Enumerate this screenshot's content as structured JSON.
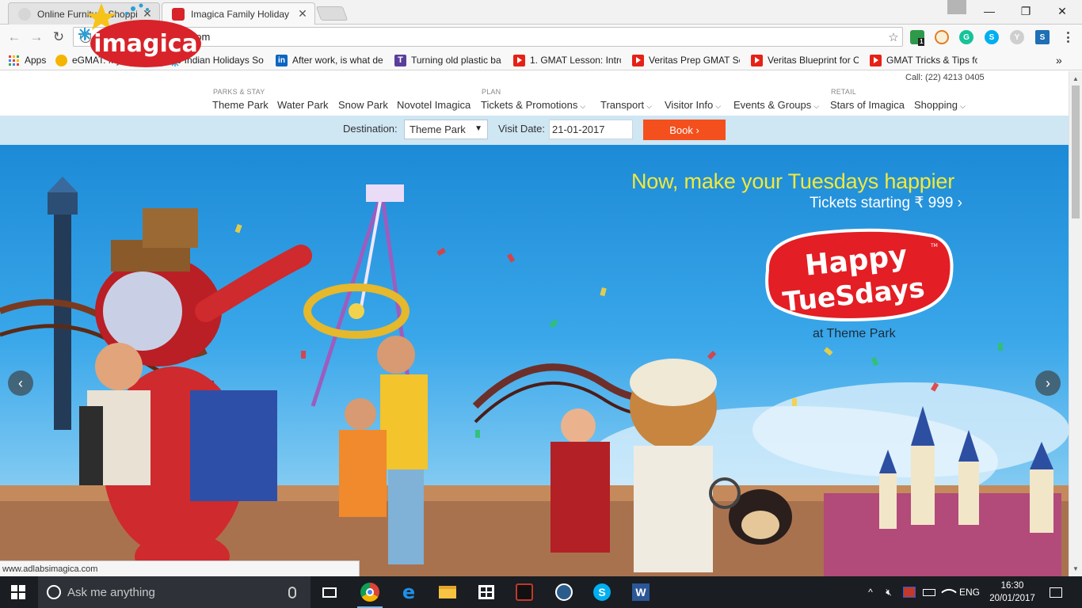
{
  "browser": {
    "tabs": [
      {
        "title": "Online Furniture Shopping",
        "favicon_color": "#d6d6d6",
        "active": false
      },
      {
        "title": "Imagica Family Holiday D",
        "favicon_color": "#d8232a",
        "active": true
      }
    ],
    "address": "www.adlabsimagica.com",
    "extension_badge": "1",
    "bookmarks": [
      {
        "label": "Apps",
        "icon": "apps-grid-icon"
      },
      {
        "label": "eGMAT: My home",
        "icon": "egmat-icon"
      },
      {
        "label": "10 Indian Holidays So",
        "icon": "map-pin-icon"
      },
      {
        "label": "After work, is what de",
        "icon": "linkedin-icon"
      },
      {
        "label": "Turning old plastic ba",
        "icon": "t-icon"
      },
      {
        "label": "1. GMAT Lesson: Intro",
        "icon": "youtube-icon"
      },
      {
        "label": "Veritas Prep GMAT Se",
        "icon": "youtube-icon"
      },
      {
        "label": "Veritas Blueprint for C",
        "icon": "youtube-icon"
      },
      {
        "label": "GMAT Tricks & Tips fo",
        "icon": "youtube-icon"
      }
    ],
    "bookmarks_overflow": "»",
    "status_url": "www.adlabsimagica.com"
  },
  "site": {
    "logo_text": "imagica",
    "call": "Call: (22) 4213 0405",
    "nav_groups": {
      "parks": "PARKS & STAY",
      "plan": "PLAN",
      "retail": "RETAIL"
    },
    "nav": [
      {
        "label": "Theme Park",
        "dropdown": false
      },
      {
        "label": "Water Park",
        "dropdown": false
      },
      {
        "label": "Snow Park",
        "dropdown": false
      },
      {
        "label": "Novotel Imagica",
        "dropdown": false
      },
      {
        "label": "Tickets & Promotions",
        "dropdown": true
      },
      {
        "label": "Transport",
        "dropdown": true
      },
      {
        "label": "Visitor Info",
        "dropdown": true
      },
      {
        "label": "Events & Groups",
        "dropdown": true
      },
      {
        "label": "Stars of Imagica",
        "dropdown": false
      },
      {
        "label": "Shopping",
        "dropdown": true
      }
    ],
    "booking": {
      "destination_label": "Destination:",
      "destination_value": "Theme Park",
      "visit_label": "Visit Date:",
      "visit_value": "21-01-2017",
      "book_label": "Book ›"
    },
    "hero": {
      "headline": "Now, make your Tuesdays happier",
      "sub": "Tickets starting ₹ 999 ›",
      "logo_line1": "Happy",
      "logo_line2": "TueSdays",
      "tm": "TM",
      "location": "at Theme Park"
    },
    "colors": {
      "brand_red": "#d8232a",
      "book_orange": "#f4501e",
      "headline_yellow": "#f2e93a",
      "booking_bar": "#cfe6f3"
    }
  },
  "taskbar": {
    "search_placeholder": "Ask me anything",
    "lang": "ENG",
    "time": "16:30",
    "date": "20/01/2017",
    "apps": [
      "task-view-icon",
      "chrome-icon",
      "edge-icon",
      "file-explorer-icon",
      "store-icon",
      "app-icon",
      "app-icon",
      "skype-icon",
      "word-icon"
    ]
  }
}
